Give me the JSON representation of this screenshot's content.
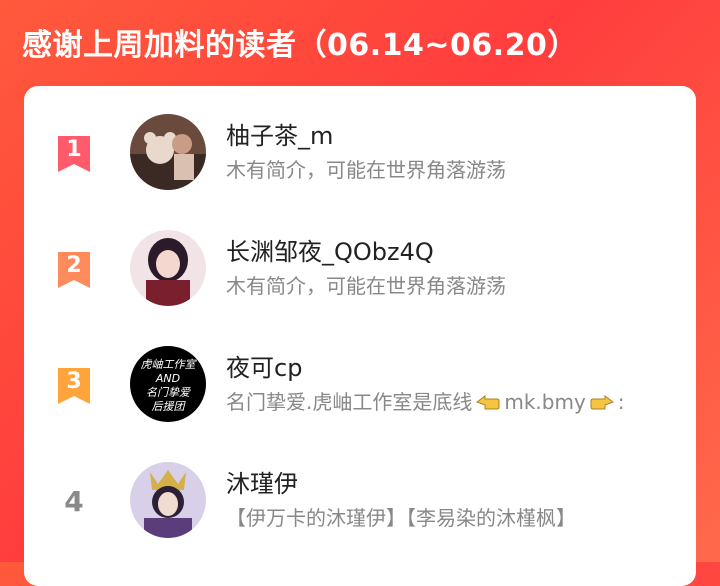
{
  "header": {
    "title": "感谢上周加料的读者（06.14~06.20）"
  },
  "readers": [
    {
      "rank": "1",
      "name": "柚子茶_m",
      "bio": "木有简介，可能在世界角落游荡",
      "badge_color": "#ff5b6b"
    },
    {
      "rank": "2",
      "name": "长渊邹夜_QObz4Q",
      "bio": "木有简介，可能在世界角落游荡",
      "badge_color": "#ff8a5b"
    },
    {
      "rank": "3",
      "name": "夜可cp",
      "bio_before": "名门挚爱.虎岫工作室是底线",
      "bio_mid": "mk.bmy",
      "bio_after": ":",
      "badge_color": "#ffa43a",
      "avatar_text": [
        "虎岫工作室",
        "AND",
        "名门挚爱",
        "后援团"
      ]
    },
    {
      "rank": "4",
      "name": "沐瑾伊",
      "bio": "【伊万卡的沐瑾伊】【李易染的沐槿枫】"
    }
  ],
  "icons": {
    "pointing": "backhand-index-pointing-left",
    "pointing2": "backhand-index-pointing-right"
  }
}
